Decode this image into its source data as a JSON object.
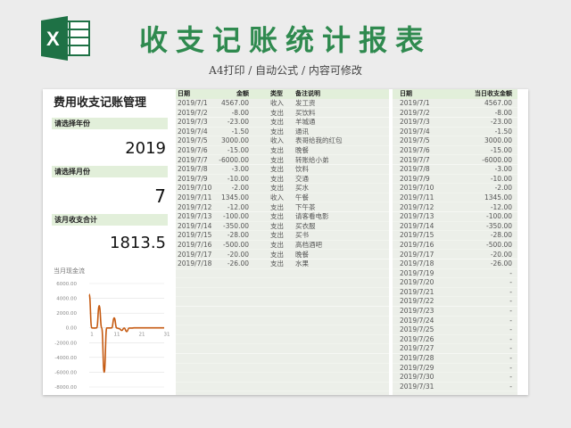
{
  "header": {
    "title": "收支记账统计报表",
    "subtitle": "A4打印 / 自动公式 / 内容可修改"
  },
  "panel": {
    "title": "费用收支记账管理",
    "year_label": "请选择年份",
    "year_value": "2019",
    "month_label": "请选择月份",
    "month_value": "7",
    "total_label": "该月收支合计",
    "total_value": "1813.5"
  },
  "chart_data": {
    "type": "line",
    "title": "当月现金流",
    "x": [
      1,
      2,
      3,
      4,
      5,
      6,
      7,
      8,
      9,
      10,
      11,
      12,
      13,
      14,
      15,
      16,
      17,
      18,
      19,
      20,
      21,
      22,
      23,
      24,
      25,
      26,
      27,
      28,
      29,
      30,
      31
    ],
    "values": [
      4567,
      -8,
      -23,
      -1.5,
      3000,
      -15,
      -6000,
      -3,
      -10,
      -2,
      1345,
      -12,
      -100,
      -350,
      -28,
      -500,
      -20,
      -26,
      0,
      0,
      0,
      0,
      0,
      0,
      0,
      0,
      0,
      0,
      0,
      0,
      0
    ],
    "yticks": [
      6000,
      4000,
      2000,
      0,
      -2000,
      -4000,
      -6000,
      -8000
    ],
    "ytick_labels": [
      "6000.00",
      "4000.00",
      "2000.00",
      "0.00",
      "-2000.00",
      "-4000.00",
      "-6000.00",
      "-8000.00"
    ],
    "xtick_labels": [
      "1",
      "11",
      "21",
      "31"
    ],
    "ylim": [
      -8000,
      6000
    ],
    "grid": true,
    "color": "#c55a11"
  },
  "ledger": {
    "headers": {
      "date": "日期",
      "amount": "金额",
      "type": "类型",
      "note": "备注说明"
    },
    "rows": [
      {
        "date": "2019/7/1",
        "amount": "4567.00",
        "type": "收入",
        "note": "发工资"
      },
      {
        "date": "2019/7/2",
        "amount": "-8.00",
        "type": "支出",
        "note": "买饮料"
      },
      {
        "date": "2019/7/3",
        "amount": "-23.00",
        "type": "支出",
        "note": "羊城通"
      },
      {
        "date": "2019/7/4",
        "amount": "-1.50",
        "type": "支出",
        "note": "通讯"
      },
      {
        "date": "2019/7/5",
        "amount": "3000.00",
        "type": "收入",
        "note": "表哥给我的红包"
      },
      {
        "date": "2019/7/6",
        "amount": "-15.00",
        "type": "支出",
        "note": "晚餐"
      },
      {
        "date": "2019/7/7",
        "amount": "-6000.00",
        "type": "支出",
        "note": "转账给小弟"
      },
      {
        "date": "2019/7/8",
        "amount": "-3.00",
        "type": "支出",
        "note": "饮料"
      },
      {
        "date": "2019/7/9",
        "amount": "-10.00",
        "type": "支出",
        "note": "交通"
      },
      {
        "date": "2019/7/10",
        "amount": "-2.00",
        "type": "支出",
        "note": "买水"
      },
      {
        "date": "2019/7/11",
        "amount": "1345.00",
        "type": "收入",
        "note": "午餐"
      },
      {
        "date": "2019/7/12",
        "amount": "-12.00",
        "type": "支出",
        "note": "下午茶"
      },
      {
        "date": "2019/7/13",
        "amount": "-100.00",
        "type": "支出",
        "note": "请客看电影"
      },
      {
        "date": "2019/7/14",
        "amount": "-350.00",
        "type": "支出",
        "note": "买衣服"
      },
      {
        "date": "2019/7/15",
        "amount": "-28.00",
        "type": "支出",
        "note": "买书"
      },
      {
        "date": "2019/7/16",
        "amount": "-500.00",
        "type": "支出",
        "note": "高档酒吧"
      },
      {
        "date": "2019/7/17",
        "amount": "-20.00",
        "type": "支出",
        "note": "晚餐"
      },
      {
        "date": "2019/7/18",
        "amount": "-26.00",
        "type": "支出",
        "note": "水果"
      }
    ]
  },
  "daily": {
    "headers": {
      "date": "日期",
      "total": "当日收支金额"
    },
    "rows": [
      {
        "date": "2019/7/1",
        "value": "4567.00"
      },
      {
        "date": "2019/7/2",
        "value": "-8.00"
      },
      {
        "date": "2019/7/3",
        "value": "-23.00"
      },
      {
        "date": "2019/7/4",
        "value": "-1.50"
      },
      {
        "date": "2019/7/5",
        "value": "3000.00"
      },
      {
        "date": "2019/7/6",
        "value": "-15.00"
      },
      {
        "date": "2019/7/7",
        "value": "-6000.00"
      },
      {
        "date": "2019/7/8",
        "value": "-3.00"
      },
      {
        "date": "2019/7/9",
        "value": "-10.00"
      },
      {
        "date": "2019/7/10",
        "value": "-2.00"
      },
      {
        "date": "2019/7/11",
        "value": "1345.00"
      },
      {
        "date": "2019/7/12",
        "value": "-12.00"
      },
      {
        "date": "2019/7/13",
        "value": "-100.00"
      },
      {
        "date": "2019/7/14",
        "value": "-350.00"
      },
      {
        "date": "2019/7/15",
        "value": "-28.00"
      },
      {
        "date": "2019/7/16",
        "value": "-500.00"
      },
      {
        "date": "2019/7/17",
        "value": "-20.00"
      },
      {
        "date": "2019/7/18",
        "value": "-26.00"
      },
      {
        "date": "2019/7/19",
        "value": "-"
      },
      {
        "date": "2019/7/20",
        "value": "-"
      },
      {
        "date": "2019/7/21",
        "value": "-"
      },
      {
        "date": "2019/7/22",
        "value": "-"
      },
      {
        "date": "2019/7/23",
        "value": "-"
      },
      {
        "date": "2019/7/24",
        "value": "-"
      },
      {
        "date": "2019/7/25",
        "value": "-"
      },
      {
        "date": "2019/7/26",
        "value": "-"
      },
      {
        "date": "2019/7/27",
        "value": "-"
      },
      {
        "date": "2019/7/28",
        "value": "-"
      },
      {
        "date": "2019/7/29",
        "value": "-"
      },
      {
        "date": "2019/7/30",
        "value": "-"
      },
      {
        "date": "2019/7/31",
        "value": "-"
      }
    ]
  },
  "colors": {
    "accent": "#2f8a4f",
    "header_fill": "#e2efda",
    "line": "#c55a11",
    "excel_green": "#1e7145"
  },
  "icons": {
    "logo": "excel-logo-icon"
  }
}
